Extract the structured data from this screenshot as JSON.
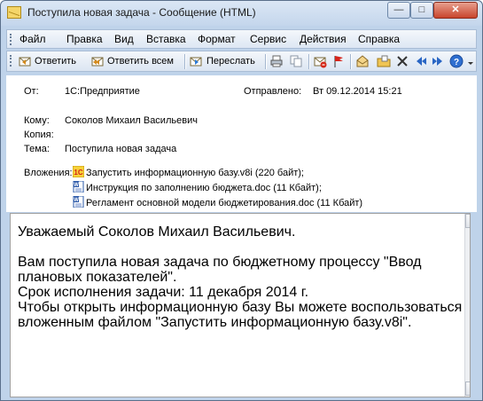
{
  "window": {
    "title": "Поступила новая задача - Сообщение (HTML)",
    "min": "—",
    "max": "□",
    "close": "✕"
  },
  "menu": {
    "items": [
      "Файл",
      "Правка",
      "Вид",
      "Вставка",
      "Формат",
      "Сервис",
      "Действия",
      "Справка"
    ]
  },
  "toolbar": {
    "reply": "Ответить",
    "reply_all": "Ответить всем",
    "forward": "Переслать"
  },
  "header": {
    "from_label": "От:",
    "from_value": "1С:Предприятие",
    "sent_label": "Отправлено:",
    "sent_value": "Вт 09.12.2014 15:21",
    "to_label": "Кому:",
    "to_value": "Соколов Михаил Васильевич",
    "cc_label": "Копия:",
    "cc_value": "",
    "subject_label": "Тема:",
    "subject_value": "Поступила новая задача",
    "attachments_label": "Вложения:",
    "attachments": [
      "Запустить информационную базу.v8i (220 байт);",
      "Инструкция по заполнению бюджета.doc (11 Кбайт);",
      "Регламент основной модели бюджетирования.doc (11 Кбайт)"
    ]
  },
  "body": {
    "lines": [
      "Уважаемый Соколов Михаил Васильевич.",
      "",
      "Вам поступила новая задача по бюджетному процессу \"Ввод",
      "плановых показателей\".",
      "Срок исполнения задачи: 11 декабря 2014 г.",
      "Чтобы открыть информационную базу Вы можете воспользоваться",
      "вложенным файлом \"Запустить информационную базу.v8i\"."
    ]
  },
  "colors": {
    "window_frame": "#bfd3ea",
    "close_button": "#c8442b"
  }
}
